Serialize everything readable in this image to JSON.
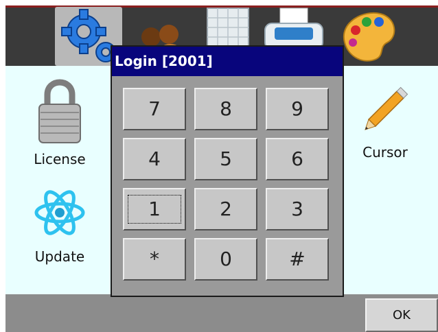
{
  "toolbar": {
    "icons": [
      "settings-gear-icon",
      "users-icon",
      "calendar-icon",
      "printer-icon",
      "palette-icon"
    ]
  },
  "apps": {
    "license": "License",
    "update": "Update",
    "cursor": "Cursor"
  },
  "dialog": {
    "title": "Login [2001]",
    "keys": [
      "7",
      "8",
      "9",
      "4",
      "5",
      "6",
      "1",
      "2",
      "3",
      "*",
      "0",
      "#"
    ],
    "focused_key": "1"
  },
  "bottom": {
    "ok_label": "OK"
  },
  "colors": {
    "titlebar": "#08057c",
    "content_bg": "#e9ffff",
    "toolbar_bg": "#3a3a3a"
  }
}
